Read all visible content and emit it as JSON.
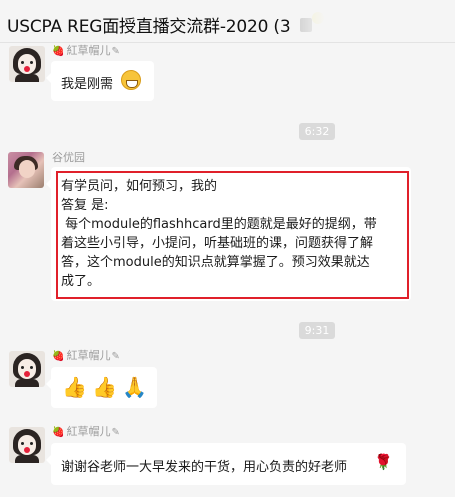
{
  "window": {
    "title": "USCPA REG面授直播交流群-2020 (3"
  },
  "messages": [
    {
      "sender": "紅草帽儿",
      "text": "我是刚需",
      "emoji": "grin-icon"
    },
    {
      "time": "6:32"
    },
    {
      "sender": "谷优园",
      "lines": [
        "有学员问，如何预习，我的",
        "答复 是:",
        " 每个module的flashhcard里的题就是最好的提纲，带",
        "着这些小引导，小提问，听基础班的课，问题获得了解",
        "答，这个module的知识点就算掌握了。预习效果就达",
        "成了。"
      ]
    },
    {
      "time": "9:31"
    },
    {
      "sender": "紅草帽儿",
      "emojis": [
        "thumbs-up-icon",
        "thumbs-up-icon",
        "clap-icon"
      ]
    },
    {
      "sender": "紅草帽儿",
      "text": "谢谢谷老师一大早发来的干货，用心负责的好老师",
      "emoji": "rose-icon"
    }
  ],
  "colors": {
    "highlight": "#e0202a",
    "background": "#f5f5f5",
    "bubble": "#ffffff"
  },
  "glyphs": {
    "strawberry": "🍓",
    "pencil": "✎",
    "thumb": "👍",
    "clap": "🙏",
    "rose": "🌹"
  }
}
